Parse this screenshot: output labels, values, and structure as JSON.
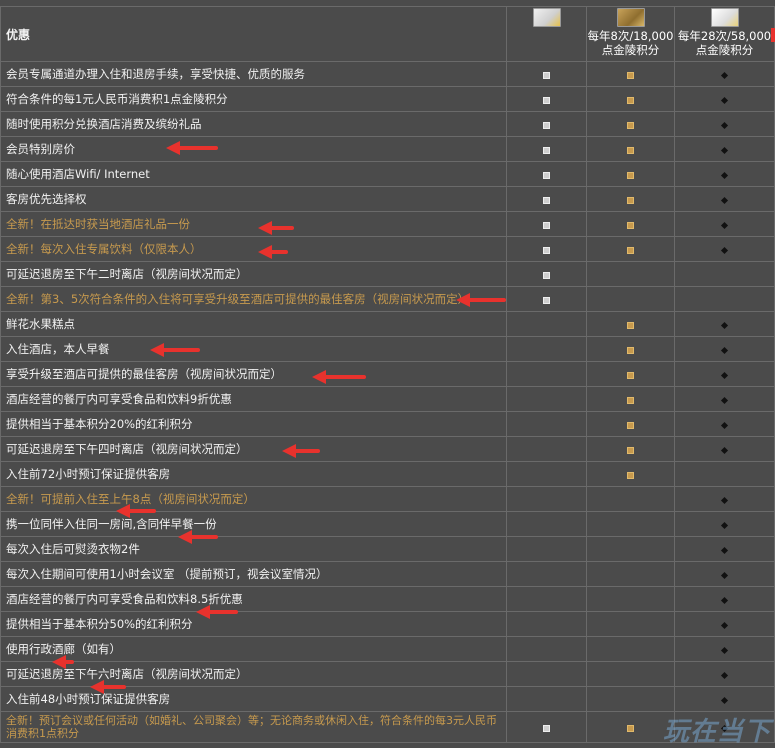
{
  "header": {
    "title": "优惠",
    "tiers": [
      {
        "card": "silver",
        "label_line1": "",
        "label_line2": ""
      },
      {
        "card": "gold",
        "label_line1": "每年8次/18,000",
        "label_line2": "点金陵积分"
      },
      {
        "card": "platinum",
        "label_line1": "每年28次/58,000",
        "label_line2": "点金陵积分"
      }
    ]
  },
  "benefits": [
    {
      "text": "会员专属通道办理入住和退房手续，享受快捷、优质的服务",
      "new": false,
      "marks": [
        "sq",
        "gsq",
        "dia"
      ]
    },
    {
      "text": "符合条件的每1元人民币消费积1点金陵积分",
      "new": false,
      "marks": [
        "sq",
        "gsq",
        "dia"
      ]
    },
    {
      "text": "随时使用积分兑换酒店消费及缤纷礼品",
      "new": false,
      "marks": [
        "sq",
        "gsq",
        "dia"
      ]
    },
    {
      "text": "会员特别房价",
      "new": false,
      "marks": [
        "sq",
        "gsq",
        "dia"
      ]
    },
    {
      "text": "随心使用酒店Wifi/ Internet",
      "new": false,
      "marks": [
        "sq",
        "gsq",
        "dia"
      ]
    },
    {
      "text": "客房优先选择权",
      "new": false,
      "marks": [
        "sq",
        "gsq",
        "dia"
      ]
    },
    {
      "text": "全新！在抵达时获当地酒店礼品一份",
      "new": true,
      "marks": [
        "sq",
        "gsq",
        "dia"
      ]
    },
    {
      "text": "全新！每次入住专属饮料（仅限本人）",
      "new": true,
      "marks": [
        "sq",
        "gsq",
        "dia"
      ]
    },
    {
      "text": "可延迟退房至下午二时离店（视房间状况而定）",
      "new": false,
      "marks": [
        "sq",
        "",
        ""
      ]
    },
    {
      "text": "全新！第3、5次符合条件的入住将可享受升级至酒店可提供的最佳客房（视房间状况而定）",
      "new": true,
      "marks": [
        "sq",
        "",
        ""
      ]
    },
    {
      "text": "鲜花水果糕点",
      "new": false,
      "marks": [
        "",
        "gsq",
        "dia"
      ]
    },
    {
      "text": "入住酒店，本人早餐",
      "new": false,
      "marks": [
        "",
        "gsq",
        "dia"
      ]
    },
    {
      "text": "享受升级至酒店可提供的最佳客房（视房间状况而定）",
      "new": false,
      "marks": [
        "",
        "gsq",
        "dia"
      ]
    },
    {
      "text": "酒店经营的餐厅内可享受食品和饮料9折优惠",
      "new": false,
      "marks": [
        "",
        "gsq",
        "dia"
      ]
    },
    {
      "text": "提供相当于基本积分20%的红利积分",
      "new": false,
      "marks": [
        "",
        "gsq",
        "dia"
      ]
    },
    {
      "text": "可延迟退房至下午四时离店（视房间状况而定）",
      "new": false,
      "marks": [
        "",
        "gsq",
        "dia"
      ]
    },
    {
      "text": "入住前72小时预订保证提供客房",
      "new": false,
      "marks": [
        "",
        "gsq",
        ""
      ]
    },
    {
      "text": "全新！可提前入住至上午8点（视房间状况而定）",
      "new": true,
      "marks": [
        "",
        "",
        "dia"
      ]
    },
    {
      "text": "携一位同伴入住同一房间,含同伴早餐一份",
      "new": false,
      "marks": [
        "",
        "",
        "dia"
      ]
    },
    {
      "text": "每次入住后可熨烫衣物2件",
      "new": false,
      "marks": [
        "",
        "",
        "dia"
      ]
    },
    {
      "text": "每次入住期间可使用1小时会议室 （提前预订，视会议室情况）",
      "new": false,
      "marks": [
        "",
        "",
        "dia"
      ]
    },
    {
      "text": "酒店经营的餐厅内可享受食品和饮料8.5折优惠",
      "new": false,
      "marks": [
        "",
        "",
        "dia"
      ]
    },
    {
      "text": "提供相当于基本积分50%的红利积分",
      "new": false,
      "marks": [
        "",
        "",
        "dia"
      ]
    },
    {
      "text": "使用行政酒廊（如有）",
      "new": false,
      "marks": [
        "",
        "",
        "dia"
      ]
    },
    {
      "text": "可延迟退房至下午六时离店（视房间状况而定）",
      "new": false,
      "marks": [
        "",
        "",
        "dia"
      ]
    },
    {
      "text": "入住前48小时预订保证提供客房",
      "new": false,
      "marks": [
        "",
        "",
        "dia"
      ]
    },
    {
      "text": "全新！预订会议或任何活动（如婚礼、公司聚会）等；无论商务或休闲入住，符合条件的每3元人民币消费积1点积分",
      "new": true,
      "marks": [
        "sq",
        "gsq",
        "dia"
      ]
    }
  ],
  "watermark": "玩在当下",
  "colors": {
    "background": "#4b4b4b",
    "border": "#6a6a6a",
    "new_text": "#c79a4e",
    "arrow": "#e8322d"
  }
}
